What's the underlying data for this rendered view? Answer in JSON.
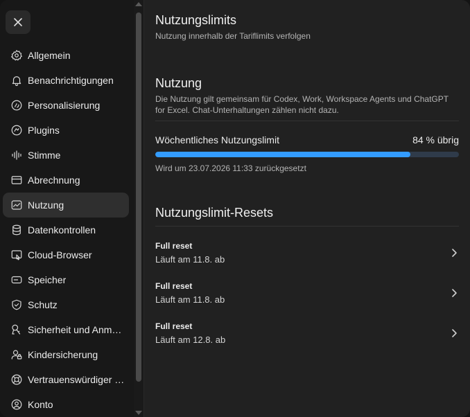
{
  "sidebar": {
    "close_icon": "close-icon",
    "items": [
      {
        "label": "Allgemein",
        "icon": "gear-icon"
      },
      {
        "label": "Benachrichtigungen",
        "icon": "bell-icon"
      },
      {
        "label": "Personalisierung",
        "icon": "personalize-icon"
      },
      {
        "label": "Plugins",
        "icon": "plugin-icon"
      },
      {
        "label": "Stimme",
        "icon": "waveform-icon"
      },
      {
        "label": "Abrechnung",
        "icon": "credit-card-icon"
      },
      {
        "label": "Nutzung",
        "icon": "usage-chart-icon",
        "active": true
      },
      {
        "label": "Datenkontrollen",
        "icon": "database-icon"
      },
      {
        "label": "Cloud-Browser",
        "icon": "cloud-browser-icon"
      },
      {
        "label": "Speicher",
        "icon": "storage-icon"
      },
      {
        "label": "Schutz",
        "icon": "shield-icon"
      },
      {
        "label": "Sicherheit und Anm…",
        "icon": "key-icon"
      },
      {
        "label": "Kindersicherung",
        "icon": "parental-control-icon"
      },
      {
        "label": "Vertrauenswürdiger …",
        "icon": "lifebuoy-icon"
      },
      {
        "label": "Konto",
        "icon": "account-icon"
      }
    ]
  },
  "main": {
    "title": "Nutzungslimits",
    "subtitle": "Nutzung innerhalb der Tariflimits verfolgen",
    "usage": {
      "heading": "Nutzung",
      "description": "Die Nutzung gilt gemeinsam für Codex, Work, Workspace Agents und ChatGPT for Excel. Chat-Unterhaltungen zählen nicht dazu.",
      "limit_label": "Wöchentliches Nutzungslimit",
      "remaining_label": "84 % übrig",
      "used_percent": 84,
      "reset_note": "Wird um 23.07.2026 11:33 zurückgesetzt",
      "bar_color": "#339cff"
    },
    "resets": {
      "heading": "Nutzungslimit-Resets",
      "items": [
        {
          "title": "Full reset",
          "subtitle": "Läuft am 11.8. ab"
        },
        {
          "title": "Full reset",
          "subtitle": "Läuft am 11.8. ab"
        },
        {
          "title": "Full reset",
          "subtitle": "Läuft am 12.8. ab"
        }
      ]
    }
  }
}
